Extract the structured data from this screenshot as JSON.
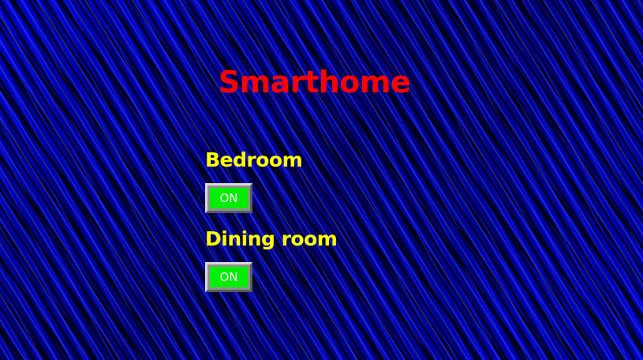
{
  "title": "Smarthome",
  "rooms": [
    {
      "label": "Bedroom",
      "toggle_label": "ON",
      "state": "on"
    },
    {
      "label": "Dining room",
      "toggle_label": "ON",
      "state": "on"
    }
  ],
  "colors": {
    "background": "#0000b0",
    "title": "#ff0000",
    "room_label": "#ffff00",
    "toggle_on": "#00ee00",
    "toggle_text": "#ffffff",
    "toggle_frame": "#8f8f8f"
  }
}
